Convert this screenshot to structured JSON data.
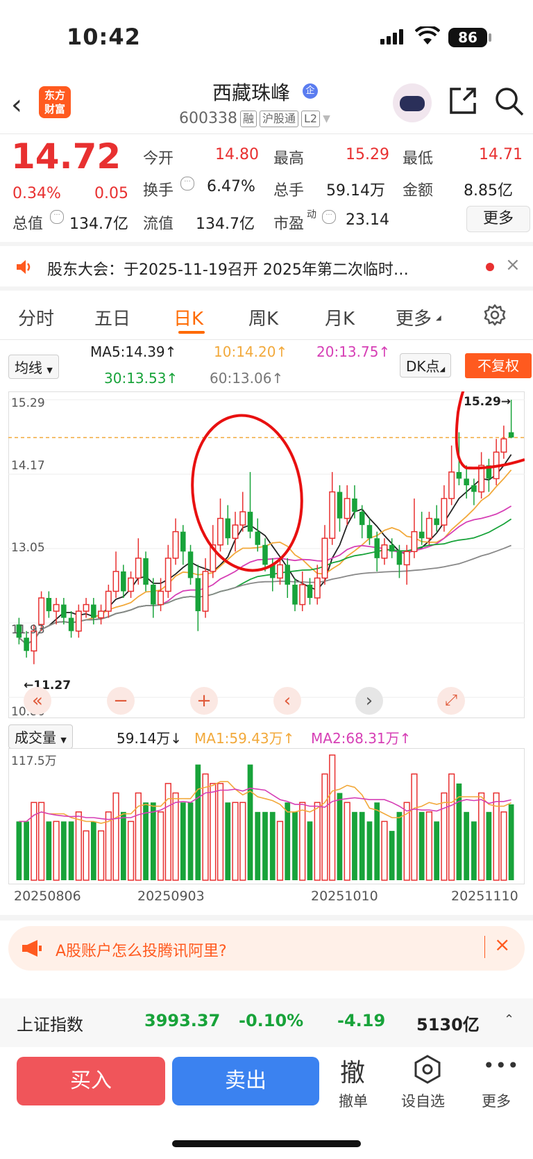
{
  "status_bar": {
    "time": "10:42",
    "battery": "86"
  },
  "header": {
    "stock_name": "西藏珠峰",
    "ent_badge": "企",
    "code": "600338",
    "tags": [
      "融",
      "沪股通",
      "L2"
    ],
    "logo_text": [
      "东方",
      "财富"
    ]
  },
  "quote": {
    "price": "14.72",
    "change_pct": "0.34%",
    "change": "0.05",
    "open_label": "今开",
    "open": "14.80",
    "high_label": "最高",
    "high": "15.29",
    "low_label": "最低",
    "low": "14.71",
    "turnover_label": "换手",
    "turnover": "6.47%",
    "volume_label": "总手",
    "volume": "59.14万",
    "amount_label": "金额",
    "amount": "8.85亿",
    "mcap_label": "总值",
    "mcap": "134.7亿",
    "float_label": "流值",
    "float": "134.7亿",
    "pe_label": "市盈",
    "pe_sup": "动",
    "pe": "23.14",
    "more": "更多"
  },
  "notice": {
    "text": "股东大会：于2025-11-19召开 2025年第二次临时…"
  },
  "tabs": [
    "分时",
    "五日",
    "日K",
    "周K",
    "月K",
    "更多"
  ],
  "active_tab": "日K",
  "kline": {
    "indicator": "均线",
    "ma5": "MA5:14.39↑",
    "ma10": "10:14.20↑",
    "ma20": "20:13.75↑",
    "ma30": "30:13.53↑",
    "ma60": "60:13.06↑",
    "dk_button": "DK点",
    "fq_button": "不复权",
    "y_labels": [
      "15.29",
      "14.17",
      "13.05",
      "11.93",
      "10.80"
    ],
    "max_label": "15.29→",
    "min_label": "←11.27"
  },
  "volume": {
    "indicator": "成交量",
    "current": "59.14万↓",
    "ma1": "MA1:59.43万↑",
    "ma2": "MA2:68.31万↑",
    "max_label": "117.5万",
    "x_labels": [
      "20250806",
      "20250903",
      "20251010",
      "20251110"
    ]
  },
  "ad": {
    "text": "A股账户怎么投腾讯阿里?"
  },
  "index": {
    "name": "上证指数",
    "value": "3993.37",
    "pct": "-0.10%",
    "change": "-4.19",
    "amount": "5130亿"
  },
  "actions": {
    "buy": "买入",
    "sell": "卖出",
    "cancel_icon": "撤",
    "cancel": "撤单",
    "watch": "设自选",
    "more": "更多"
  },
  "colors": {
    "up": "#e83030",
    "down": "#18a33a",
    "accent": "#ff6a00"
  },
  "chart_data": {
    "type": "candlestick",
    "x_labels": [
      "20250806",
      "20250903",
      "20251010",
      "20251110"
    ],
    "ylim": [
      10.8,
      15.29
    ],
    "candles": [
      [
        11.9,
        11.7,
        12.0,
        11.6
      ],
      [
        11.7,
        11.5,
        11.8,
        11.4
      ],
      [
        11.5,
        11.8,
        11.9,
        11.3
      ],
      [
        11.9,
        12.3,
        12.4,
        11.8
      ],
      [
        12.3,
        12.1,
        12.4,
        12.0
      ],
      [
        12.1,
        12.2,
        12.3,
        11.9
      ],
      [
        12.2,
        12.0,
        12.3,
        11.9
      ],
      [
        12.0,
        11.8,
        12.1,
        11.7
      ],
      [
        11.8,
        12.1,
        12.2,
        11.7
      ],
      [
        12.1,
        12.2,
        12.3,
        12.0
      ],
      [
        12.2,
        12.0,
        12.3,
        11.9
      ],
      [
        12.0,
        12.1,
        12.2,
        11.9
      ],
      [
        12.1,
        12.4,
        12.5,
        12.0
      ],
      [
        12.4,
        12.7,
        13.0,
        12.3
      ],
      [
        12.7,
        12.4,
        12.8,
        12.3
      ],
      [
        12.4,
        12.6,
        12.7,
        12.3
      ],
      [
        12.6,
        12.9,
        13.2,
        12.5
      ],
      [
        12.9,
        12.5,
        13.0,
        12.4
      ],
      [
        12.5,
        12.2,
        12.6,
        12.0
      ],
      [
        12.2,
        12.4,
        12.6,
        12.1
      ],
      [
        12.4,
        12.9,
        13.1,
        12.3
      ],
      [
        12.9,
        13.3,
        13.5,
        12.8
      ],
      [
        13.3,
        13.0,
        13.4,
        12.8
      ],
      [
        13.0,
        12.6,
        13.1,
        12.5
      ],
      [
        12.6,
        12.1,
        12.8,
        11.8
      ],
      [
        12.1,
        12.7,
        12.9,
        12.0
      ],
      [
        12.7,
        13.1,
        13.4,
        12.6
      ],
      [
        13.1,
        13.5,
        13.8,
        13.0
      ],
      [
        13.5,
        13.2,
        13.7,
        13.1
      ],
      [
        13.2,
        13.4,
        13.6,
        13.0
      ],
      [
        13.4,
        13.6,
        13.9,
        13.3
      ],
      [
        13.6,
        13.3,
        14.2,
        13.2
      ],
      [
        13.3,
        13.1,
        13.5,
        13.0
      ],
      [
        13.1,
        12.8,
        13.2,
        12.7
      ],
      [
        12.8,
        12.6,
        12.9,
        12.4
      ],
      [
        12.6,
        12.8,
        12.9,
        12.5
      ],
      [
        12.8,
        12.5,
        12.9,
        12.3
      ],
      [
        12.5,
        12.2,
        12.6,
        12.1
      ],
      [
        12.2,
        12.5,
        12.7,
        12.1
      ],
      [
        12.5,
        12.3,
        12.6,
        12.2
      ],
      [
        12.3,
        12.6,
        12.8,
        12.2
      ],
      [
        12.6,
        13.2,
        13.4,
        12.5
      ],
      [
        13.2,
        13.9,
        14.2,
        13.1
      ],
      [
        13.9,
        13.5,
        14.0,
        13.3
      ],
      [
        13.5,
        13.8,
        14.0,
        13.4
      ],
      [
        13.8,
        13.6,
        14.0,
        13.5
      ],
      [
        13.6,
        13.4,
        13.7,
        13.2
      ],
      [
        13.4,
        13.2,
        13.5,
        13.1
      ],
      [
        13.2,
        12.9,
        13.3,
        12.7
      ],
      [
        12.9,
        13.1,
        13.2,
        12.8
      ],
      [
        13.1,
        13.0,
        13.2,
        12.9
      ],
      [
        13.0,
        12.8,
        13.1,
        12.6
      ],
      [
        12.8,
        13.0,
        13.1,
        12.5
      ],
      [
        13.0,
        13.3,
        13.8,
        12.9
      ],
      [
        13.3,
        13.2,
        13.6,
        13.1
      ],
      [
        13.2,
        13.5,
        13.6,
        13.1
      ],
      [
        13.5,
        13.4,
        13.7,
        13.3
      ],
      [
        13.4,
        13.8,
        14.0,
        13.3
      ],
      [
        13.8,
        14.2,
        14.6,
        13.7
      ],
      [
        14.2,
        14.1,
        14.8,
        14.0
      ],
      [
        14.1,
        14.0,
        14.3,
        13.8
      ],
      [
        14.0,
        13.9,
        14.1,
        13.7
      ],
      [
        13.9,
        14.3,
        14.5,
        13.8
      ],
      [
        14.3,
        14.1,
        14.4,
        13.9
      ],
      [
        14.1,
        14.5,
        14.7,
        14.0
      ],
      [
        14.5,
        14.7,
        14.9,
        14.4
      ],
      [
        14.8,
        14.72,
        15.29,
        14.71
      ]
    ]
  }
}
